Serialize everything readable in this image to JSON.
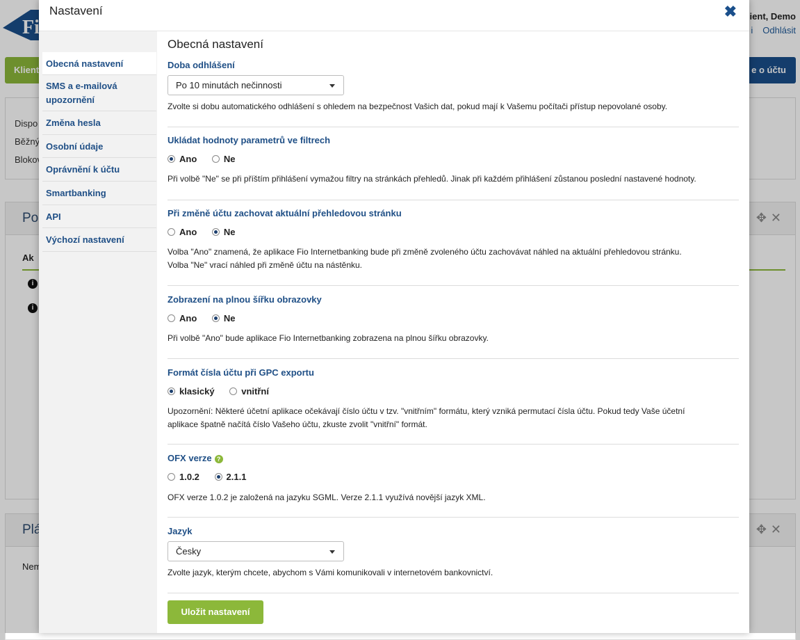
{
  "background": {
    "user_name": "ient, Demo",
    "logout_link": "Odhlásit",
    "link_prefix": "i",
    "green_button": "Klient",
    "blue_button": "e o účtu",
    "panel1_lines": [
      "Dispo",
      "Běžný",
      "Blokov"
    ],
    "panel2_title": "Pol",
    "panel2_col": "Ak",
    "panel3_title": "Plá",
    "panel3_text": "Nem"
  },
  "modal": {
    "title": "Nastavení",
    "close_icon": "close-icon"
  },
  "sidebar": {
    "items": [
      {
        "label": "Obecná nastavení",
        "active": true
      },
      {
        "label": "SMS a e-mailová upozornění"
      },
      {
        "label": "Změna hesla"
      },
      {
        "label": "Osobní údaje"
      },
      {
        "label": "Oprávnění k účtu"
      },
      {
        "label": "Smartbanking"
      },
      {
        "label": "API"
      },
      {
        "label": "Výchozí nastavení"
      }
    ]
  },
  "content": {
    "title": "Obecná nastavení",
    "logout": {
      "heading": "Doba odhlášení",
      "selected": "Po 10 minutách nečinnosti",
      "desc": "Zvolte si dobu automatického odhlášení s ohledem na bezpečnost Vašich dat, pokud mají k Vašemu počítači přístup nepovolané osoby."
    },
    "filters": {
      "heading": "Ukládat hodnoty parametrů ve filtrech",
      "opt_yes": "Ano",
      "opt_no": "Ne",
      "selected": "Ano",
      "desc": "Při volbě \"Ne\" se při příštím přihlášení vymažou filtry na stránkách přehledů. Jinak při každém přihlášení zůstanou poslední nastavené hodnoty."
    },
    "keep_page": {
      "heading": "Při změně účtu zachovat aktuální přehledovou stránku",
      "opt_yes": "Ano",
      "opt_no": "Ne",
      "selected": "Ne",
      "desc_line1": "Volba \"Ano\" znamená, že aplikace Fio Internetbanking bude při změně zvoleného účtu zachovávat náhled na aktuální přehledovou stránku.",
      "desc_line2": "Volba \"Ne\" vrací náhled při změně účtu na nástěnku."
    },
    "fullwidth": {
      "heading": "Zobrazení na plnou šířku obrazovky",
      "opt_yes": "Ano",
      "opt_no": "Ne",
      "selected": "Ne",
      "desc": "Při volbě \"Ano\" bude aplikace Fio Internetbanking zobrazena na plnou šířku obrazovky."
    },
    "gpc": {
      "heading": "Formát čísla účtu při GPC exportu",
      "opt_1": "klasický",
      "opt_2": "vnitřní",
      "selected": "klasický",
      "desc_line1": "Upozornění: Některé účetní aplikace očekávají číslo účtu v tzv. \"vnitřním\" formátu, který vzniká permutací čísla účtu. Pokud tedy Vaše účetní",
      "desc_line2": "aplikace špatně načítá číslo Vašeho účtu, zkuste zvolit \"vnitřní\" formát."
    },
    "ofx": {
      "heading": "OFX verze",
      "help_icon": "question-icon",
      "opt_1": "1.0.2",
      "opt_2": "2.1.1",
      "selected": "2.1.1",
      "desc": "OFX verze 1.0.2 je založená na jazyku SGML. Verze 2.1.1 využívá novější jazyk XML."
    },
    "language": {
      "heading": "Jazyk",
      "selected": "Česky",
      "desc": "Zvolte jazyk, kterým chcete, abychom s Vámi komunikovali v internetovém bankovnictví."
    },
    "save_label": "Uložit nastavení"
  },
  "colors": {
    "brand_blue": "#1f4f86",
    "brand_green": "#8cb83a"
  }
}
